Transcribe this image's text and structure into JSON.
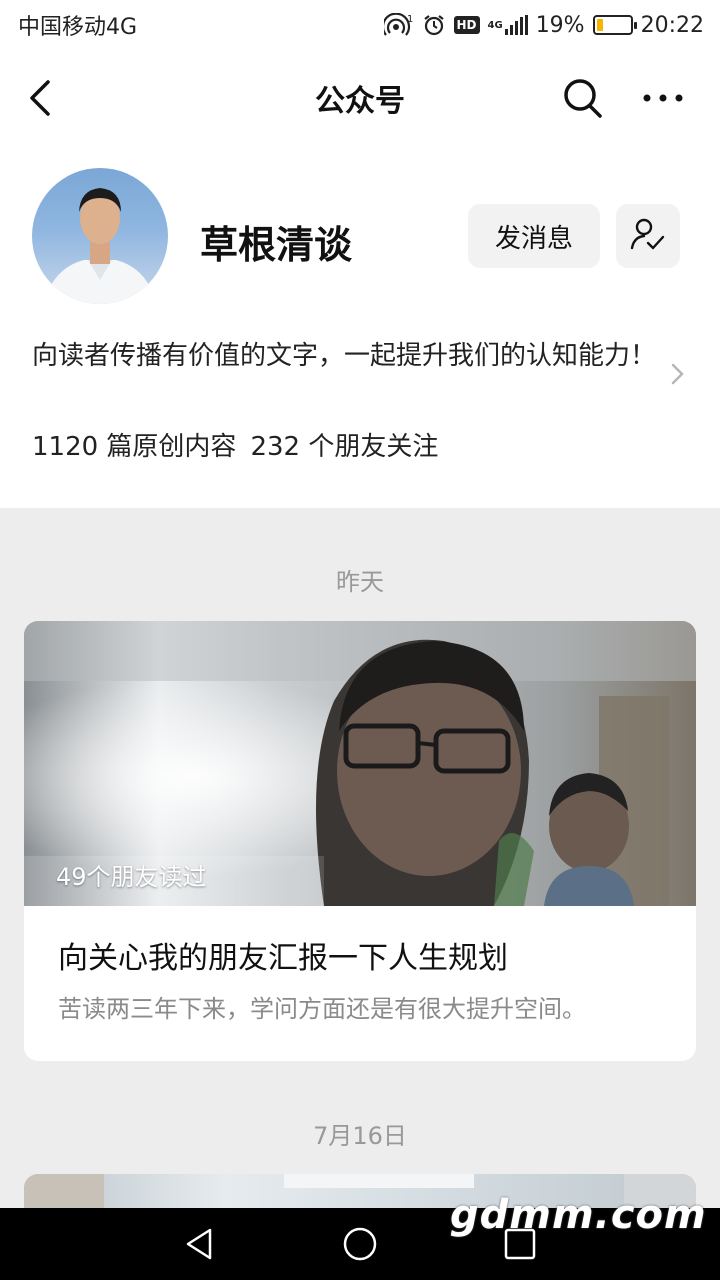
{
  "status_bar": {
    "carrier": "中国移动4G",
    "hotspot_badge": "1",
    "hd_badge": "HD",
    "network": "4G",
    "battery_percent": "19%",
    "battery_level": 0.19,
    "time": "20:22"
  },
  "nav": {
    "title": "公众号",
    "icons": [
      "back-arrow-icon",
      "search-icon",
      "more-icon"
    ]
  },
  "profile": {
    "name": "草根清谈",
    "message_button": "发消息",
    "description": "向读者传播有价值的文字，一起提升我们的认知能力！",
    "original_count": "1120 篇原创内容",
    "follower_count": "232 个朋友关注"
  },
  "feed": {
    "dates": [
      "昨天",
      "7月16日"
    ],
    "articles": [
      {
        "read_by_friends": "49个朋友读过",
        "title": "向关心我的朋友汇报一下人生规划",
        "digest": "苦读两三年下来，学问方面还是有很大提升空间。"
      }
    ]
  },
  "watermark": "gdmm.com",
  "colors": {
    "background": "#ededed",
    "card": "#ffffff",
    "button_bg": "#f2f2f2",
    "battery": "#f5b400",
    "muted_text": "#999999"
  }
}
